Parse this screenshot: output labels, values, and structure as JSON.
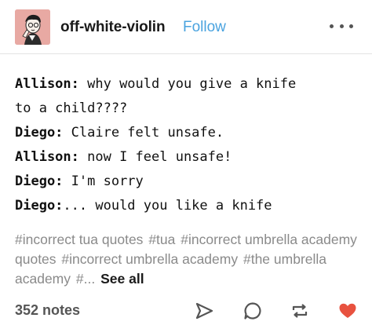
{
  "post": {
    "username": "off-white-violin",
    "follow_label": "Follow",
    "chat": [
      {
        "speaker": "Allison:",
        "text": " why would you give a knife"
      },
      {
        "speaker": "",
        "text": "to a child????"
      },
      {
        "speaker": "Diego:",
        "text": " Claire felt unsafe."
      },
      {
        "speaker": "Allison:",
        "text": " now I feel unsafe!"
      },
      {
        "speaker": "Diego:",
        "text": " I'm sorry"
      },
      {
        "speaker": "Diego:",
        "text": "... would you like a knife"
      }
    ],
    "tags": [
      "#incorrect tua quotes",
      "#tua",
      "#incorrect umbrella academy quotes",
      "#incorrect umbrella academy",
      "#the umbrella academy",
      "#..."
    ],
    "see_all_label": "See all",
    "notes_label": "352 notes"
  },
  "colors": {
    "accent": "#4aa3df",
    "like": "#e8523f",
    "tag_text": "#8a8a8a",
    "avatar_bg": "#e8a9a3"
  },
  "icons": [
    "more-icon",
    "share-icon",
    "reply-icon",
    "reblog-icon",
    "like-icon"
  ]
}
